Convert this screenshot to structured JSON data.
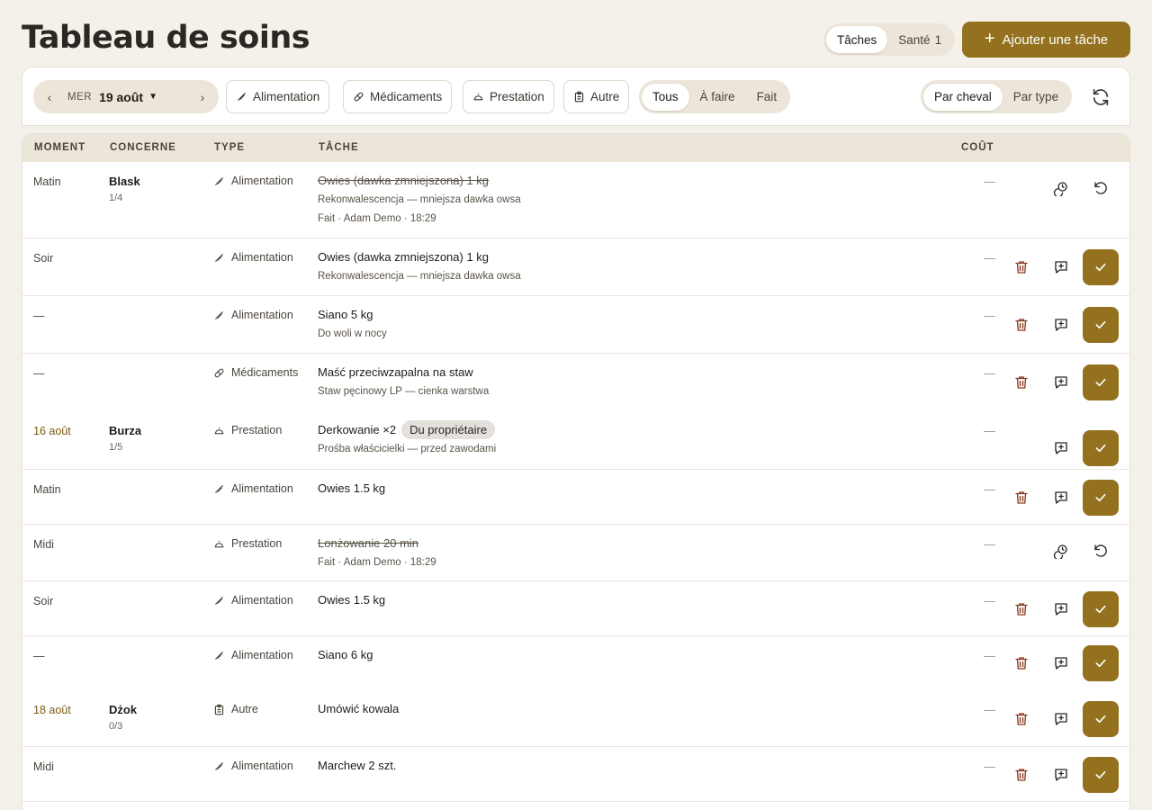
{
  "page": {
    "title": "Tableau de soins"
  },
  "view_tabs": [
    {
      "label": "Tâches",
      "badge": ""
    },
    {
      "label": "Santé",
      "badge": "1"
    }
  ],
  "add_button": {
    "label": "Ajouter une tâche"
  },
  "toolbar": {
    "date_nav": {
      "weekday": "MER",
      "date": "19 août"
    },
    "type_filters": [
      "Alimentation",
      "Médicaments",
      "Prestation",
      "Autre"
    ],
    "status_filters": [
      "Tous",
      "À faire",
      "Fait"
    ],
    "grouping": [
      "Par cheval",
      "Par type"
    ]
  },
  "table": {
    "headers": {
      "moment": "MOMENT",
      "concerne": "CONCERNE",
      "type": "TYPE",
      "tache": "TÂCHE",
      "cout": "COÛT"
    },
    "rows": [
      {
        "moment": "Matin",
        "horse": "Blask",
        "horse_sub": "1/4",
        "type": "Alimentation",
        "task": "Owies (dawka zmniejszona) 1 kg",
        "sub1": "Rekonwalescencja — mniejsza dawka owsa",
        "sub2": "Fait · Adam Demo · 18:29",
        "pill": "",
        "cost": "—",
        "done": true
      },
      {
        "moment": "Soir",
        "horse": "",
        "horse_sub": "",
        "type": "Alimentation",
        "task": "Owies (dawka zmniejszona) 1 kg",
        "sub1": "Rekonwalescencja — mniejsza dawka owsa",
        "sub2": "",
        "pill": "",
        "cost": "—",
        "done": false
      },
      {
        "moment": "—",
        "horse": "",
        "horse_sub": "",
        "type": "Alimentation",
        "task": "Siano 5 kg",
        "sub1": "Do woli w nocy",
        "sub2": "",
        "pill": "",
        "cost": "—",
        "done": false
      },
      {
        "moment": "—",
        "horse": "",
        "horse_sub": "",
        "type": "Médicaments",
        "task": "Maść przeciwzapalna na staw",
        "sub1": "Staw pęcinowy LP — cienka warstwa",
        "sub2": "",
        "pill": "",
        "cost": "—",
        "done": false
      },
      {
        "moment": "16 août",
        "horse": "Burza",
        "horse_sub": "1/5",
        "type": "Prestation",
        "task": "Derkowanie ×2",
        "sub1": "Prośba właścicielki — przed zawodami",
        "sub2": "",
        "pill": "Du propriétaire",
        "cost": "—",
        "done": false
      },
      {
        "moment": "Matin",
        "horse": "",
        "horse_sub": "",
        "type": "Alimentation",
        "task": "Owies 1.5 kg",
        "sub1": "",
        "sub2": "",
        "pill": "",
        "cost": "—",
        "done": false
      },
      {
        "moment": "Midi",
        "horse": "",
        "horse_sub": "",
        "type": "Prestation",
        "task": "Lonżowanie 20 min",
        "sub1": "Fait · Adam Demo · 18:29",
        "sub2": "",
        "pill": "",
        "cost": "—",
        "done": true
      },
      {
        "moment": "Soir",
        "horse": "",
        "horse_sub": "",
        "type": "Alimentation",
        "task": "Owies 1.5 kg",
        "sub1": "",
        "sub2": "",
        "pill": "",
        "cost": "—",
        "done": false
      },
      {
        "moment": "—",
        "horse": "",
        "horse_sub": "",
        "type": "Alimentation",
        "task": "Siano 6 kg",
        "sub1": "",
        "sub2": "",
        "pill": "",
        "cost": "—",
        "done": false
      },
      {
        "moment": "18 août",
        "horse": "Dżok",
        "horse_sub": "0/3",
        "type": "Autre",
        "task": "Umówić kowala",
        "sub1": "",
        "sub2": "",
        "pill": "",
        "cost": "—",
        "done": false
      },
      {
        "moment": "Midi",
        "horse": "",
        "horse_sub": "",
        "type": "Alimentation",
        "task": "Marchew 2 szt.",
        "sub1": "",
        "sub2": "",
        "pill": "",
        "cost": "—",
        "done": false
      }
    ]
  },
  "colors": {
    "accent": "#93711f",
    "background": "#f4f1ea",
    "header": "#ece5d9",
    "date_text": "#7a5c12"
  }
}
